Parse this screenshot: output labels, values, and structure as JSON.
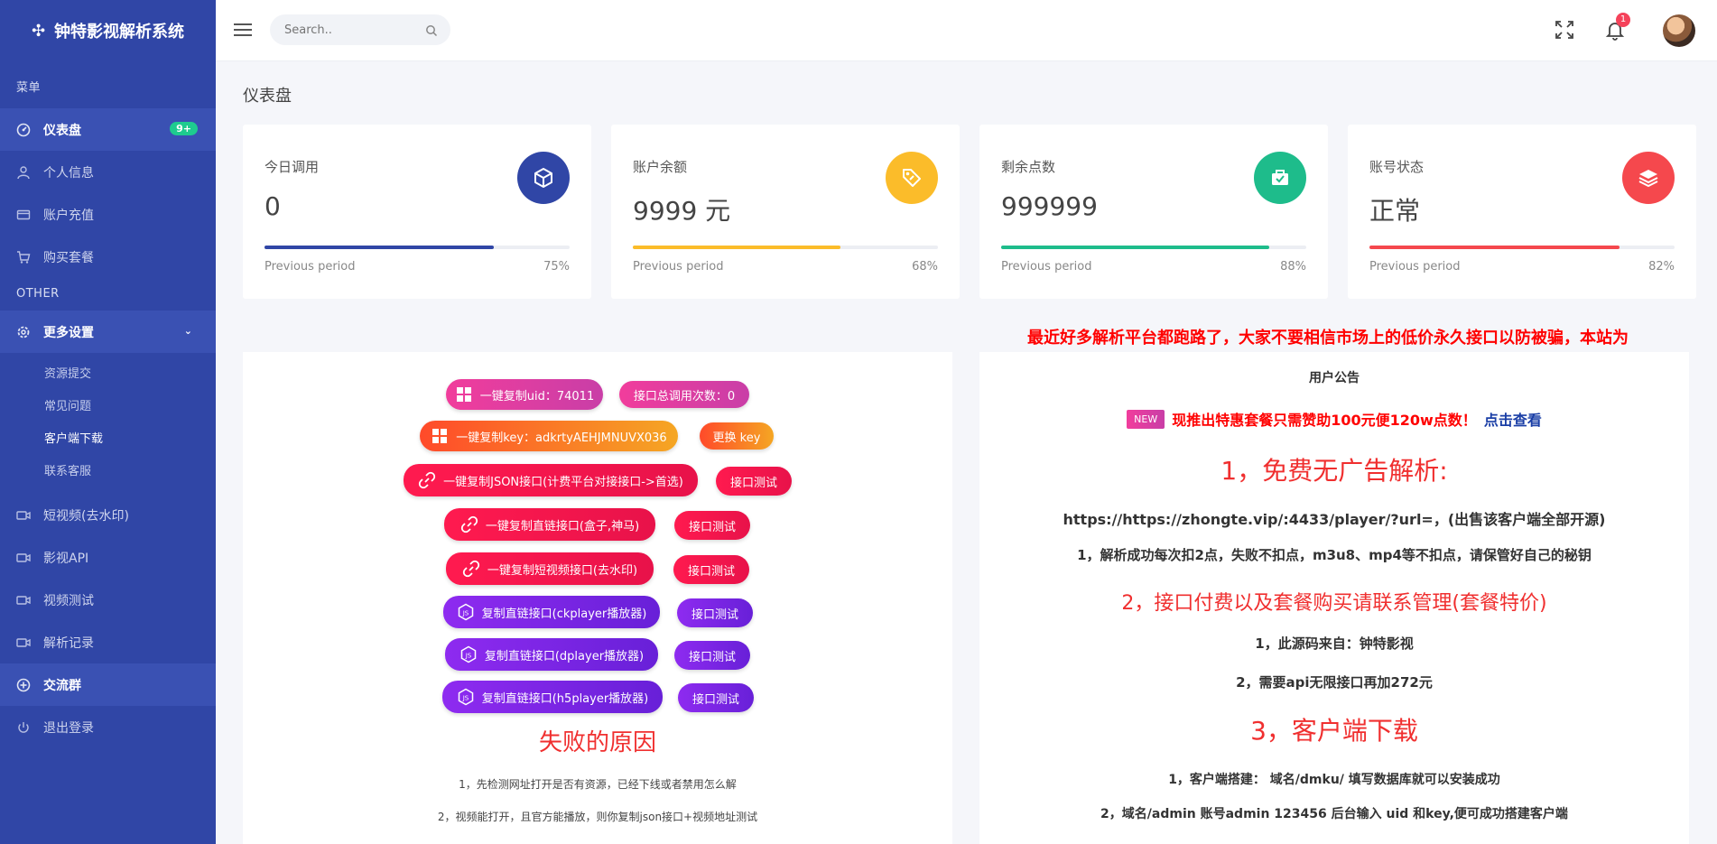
{
  "brand": {
    "name": "钟特影视解析系统"
  },
  "sidebar": {
    "section_menu": "菜单",
    "section_other": "OTHER",
    "items": [
      {
        "label": "仪表盘",
        "badge": "9+"
      },
      {
        "label": "个人信息"
      },
      {
        "label": "账户充值"
      },
      {
        "label": "购买套餐"
      }
    ],
    "more_settings": "更多设置",
    "sub_items": [
      "资源提交",
      "常见问题",
      "客户端下载",
      "联系客服"
    ],
    "other_items": [
      "短视频(去水印)",
      "影视API",
      "视频测试",
      "解析记录",
      "交流群",
      "退出登录"
    ]
  },
  "topbar": {
    "search_placeholder": "Search..",
    "notif_count": "1"
  },
  "page": {
    "title": "仪表盘"
  },
  "cards": [
    {
      "label": "今日调用",
      "value": "0",
      "progress": 75,
      "prev": "Previous period",
      "pct": "75%",
      "color": "#3046a6"
    },
    {
      "label": "账户余额",
      "value": "9999 元",
      "progress": 68,
      "prev": "Previous period",
      "pct": "68%",
      "color": "#fbbc2a"
    },
    {
      "label": "剩余点数",
      "value": "999999",
      "progress": 88,
      "prev": "Previous period",
      "pct": "88%",
      "color": "#1ebc8b"
    },
    {
      "label": "账号状态",
      "value": "正常",
      "progress": 82,
      "prev": "Previous period",
      "pct": "82%",
      "color": "#f5484d"
    }
  ],
  "marquee": "最近好多解析平台都跑路了，大家不要相信市场上的低价永久接口以防被骗，本站为",
  "buttons": {
    "copy_uid": "一键复制uid：74011",
    "call_count": "接口总调用次数：0",
    "copy_key": "一键复制key：adkrtyAEHJMNUVX036",
    "change_key": "更换 key",
    "copy_json": "一键复制JSON接口(计费平台对接接口->首选)",
    "test": "接口测试",
    "copy_direct": "一键复制直链接口(盒子,神马)",
    "copy_short": "一键复制短视频接口(去水印)",
    "copy_ck": "复制直链接口(ckplayer播放器)",
    "copy_dp": "复制直链接口(dplayer播放器)",
    "copy_h5": "复制直链接口(h5player播放器)"
  },
  "failure": {
    "title": "失败的原因",
    "lines": [
      "1，先检测网址打开是否有资源，已经下线或者禁用怎么解",
      "2，视频能打开，且官方能播放，则你复制json接口+视频地址测试"
    ]
  },
  "notice": {
    "head": "用户公告",
    "new_tag": "NEW",
    "promo": "现推出特惠套餐只需赞助100元便120w点数！",
    "promo_link": "点击查看",
    "h1": "1，免费无广告解析:",
    "url_line": "https://https://zhongte.vip/:4433/player/?url=，(出售该客户端全部开源)",
    "rule1": "1，解析成功每次扣2点，失败不扣点，m3u8、mp4等不扣点，请保管好自己的秘钥",
    "h2": "2，接口付费以及套餐购买请联系管理(套餐特价)",
    "src": "1，此源码来自：钟特影视",
    "api": "2，需要api无限接口再加272元",
    "h3": "3，客户端下载",
    "client1": "1，客户端搭建：  域名/dmku/ 填写数据库就可以安装成功",
    "client2": "2，域名/admin 账号admin 123456 后台输入 uid 和key,便可成功搭建客户端"
  }
}
